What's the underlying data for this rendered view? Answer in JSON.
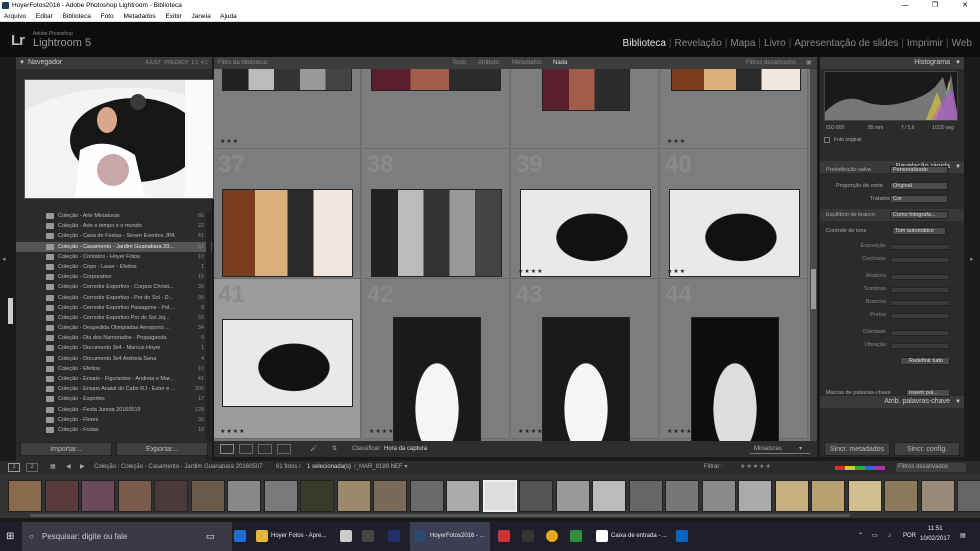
{
  "window": {
    "title": "HoyerFotos2016 - Adobe Photoshop Lightroom - Biblioteca"
  },
  "menu": [
    "Arquivo",
    "Editar",
    "Biblioteca",
    "Foto",
    "Metadados",
    "Exibir",
    "Janela",
    "Ajuda"
  ],
  "brand": {
    "logo": "Lr",
    "small": "Adobe Photoshop",
    "name": "Lightroom 5"
  },
  "modules": [
    {
      "label": "Biblioteca",
      "active": true
    },
    {
      "label": "Revelação"
    },
    {
      "label": "Mapa"
    },
    {
      "label": "Livro"
    },
    {
      "label": "Apresentação de slides"
    },
    {
      "label": "Imprimir"
    },
    {
      "label": "Web"
    }
  ],
  "navigator": {
    "title": "Navegador",
    "zoom_options": [
      "AJUST",
      "PREENCH",
      "1:1",
      "4:1"
    ]
  },
  "collections": [
    {
      "name": "Coleção - Arte Miniaturas",
      "count": "66"
    },
    {
      "name": "Coleção - Arte o tempo e o mundo",
      "count": "22"
    },
    {
      "name": "Coleção - Casa de Festas - Seven Eventos JPA",
      "count": "41"
    },
    {
      "name": "Coleção - Casamento - Jardim Guanabara 20...",
      "count": "61",
      "selected": true
    },
    {
      "name": "Coleção - Contatos - Hoyer Fotos",
      "count": "10"
    },
    {
      "name": "Coleção - Copo - Laser - Efeitos",
      "count": "1"
    },
    {
      "name": "Coleção - Corporativo",
      "count": "15"
    },
    {
      "name": "Coleção - Corredor Esportivo - Corpus Christi...",
      "count": "36"
    },
    {
      "name": "Coleção - Corredor Esportivo - Por do Sol - D...",
      "count": "90"
    },
    {
      "name": "Coleção - Corredor Esportivo Paisagens - Pol...",
      "count": "8"
    },
    {
      "name": "Coleção - Corredor Esportivo Por do Sol Joj...",
      "count": "55"
    },
    {
      "name": "Coleção - Despedida Olimpiadas Aeroporto ...",
      "count": "34"
    },
    {
      "name": "Coleção - Dia dos Namorados - Propaganda",
      "count": "8"
    },
    {
      "name": "Coleção - Documento 3x4 - Marcus Hoyer",
      "count": "1"
    },
    {
      "name": "Coleção - Documento 3x4 Andreia Sena",
      "count": "4"
    },
    {
      "name": "Coleção - Efeitos",
      "count": "10"
    },
    {
      "name": "Coleção - Ensaio - Figurantes - Andreia e Mar...",
      "count": "41"
    },
    {
      "name": "Coleção - Ensaio Anaial do Cabo RJ - Ester e ...",
      "count": "206"
    },
    {
      "name": "Coleção - Esportes",
      "count": "17"
    },
    {
      "name": "Coleção - Festa Junina 20160519",
      "count": "128"
    },
    {
      "name": "Coleção - Flores",
      "count": "36"
    },
    {
      "name": "Coleção - Frutas",
      "count": "10"
    }
  ],
  "left_buttons": {
    "import": "Importar...",
    "export": "Exportar..."
  },
  "filter_bar": {
    "label": "Filtro da biblioteca:",
    "text": "Texto",
    "attribute": "Atributo",
    "metadata": "Metadados",
    "none": "Nada",
    "off": "Filtros desativados"
  },
  "grid": [
    {
      "num": "",
      "stars": "★★★"
    },
    {
      "num": "",
      "stars": ""
    },
    {
      "num": "",
      "stars": ""
    },
    {
      "num": "",
      "stars": "★★★"
    },
    {
      "num": "37",
      "stars": ""
    },
    {
      "num": "38",
      "stars": ""
    },
    {
      "num": "39",
      "stars": "★★★★"
    },
    {
      "num": "40",
      "stars": "★★★"
    },
    {
      "num": "41",
      "stars": "★★★★"
    },
    {
      "num": "42",
      "stars": "★★★★"
    },
    {
      "num": "43",
      "stars": "★★★★"
    },
    {
      "num": "44",
      "stars": "★★★★"
    }
  ],
  "toolbar": {
    "sort_label": "Classificar:",
    "sort_value": "Hora da captura",
    "thumbs_label": "Miniaturas"
  },
  "right_panel": {
    "histogram": "Histograma",
    "iso": "ISO 800",
    "focal": "85 mm",
    "aperture": "f / 5,6",
    "shutter": "1/320 seg",
    "original": "Foto original",
    "quick_develop": "Revelação rápida",
    "preset_label": "Predefinição salva",
    "preset_value": "Personalizado",
    "crop_label": "Proporção de corte",
    "crop_value": "Original",
    "treatment_label": "Tratamento",
    "treatment_value": "Cor",
    "wb_label": "Equilíbrio de branco",
    "wb_value": "Como fotografa...",
    "tone_label": "Controle de tons",
    "tone_value": "Tom automático",
    "sliders": [
      "Exposição",
      "Contraste",
      "Realces",
      "Sombras",
      "Brancos",
      "Pretos",
      "Claridade",
      "Vibração"
    ],
    "reset": "Redefinir tudo",
    "keywords": "Atrib. palavras-chave",
    "keyword_label": "Marcas de palavras-chave",
    "keyword_value": "Inserir pal..."
  },
  "right_buttons": {
    "sync_meta": "Sincr. metadados",
    "sync_settings": "Sincr. config."
  },
  "filmbar": {
    "page1": "1",
    "page2": "2",
    "path": "Coleção : Coleção - Casamento - Jardim Guanabara 20160507",
    "count": "61 fotos /",
    "selected": "1 selecionada(s)",
    "file": "/_MAR_8189.NEF ▾",
    "filter": "Filtrar :",
    "filter_off": "Filtros desativados"
  },
  "taskbar": {
    "search": "Pesquisar: digite ou fale",
    "apps": [
      "Hoyer Fotos - Apre...",
      "HoyerFotos2016 - ...",
      "Caixa de entrada - ..."
    ],
    "lang": "POR",
    "time": "11:51",
    "date": "10/02/2017"
  }
}
